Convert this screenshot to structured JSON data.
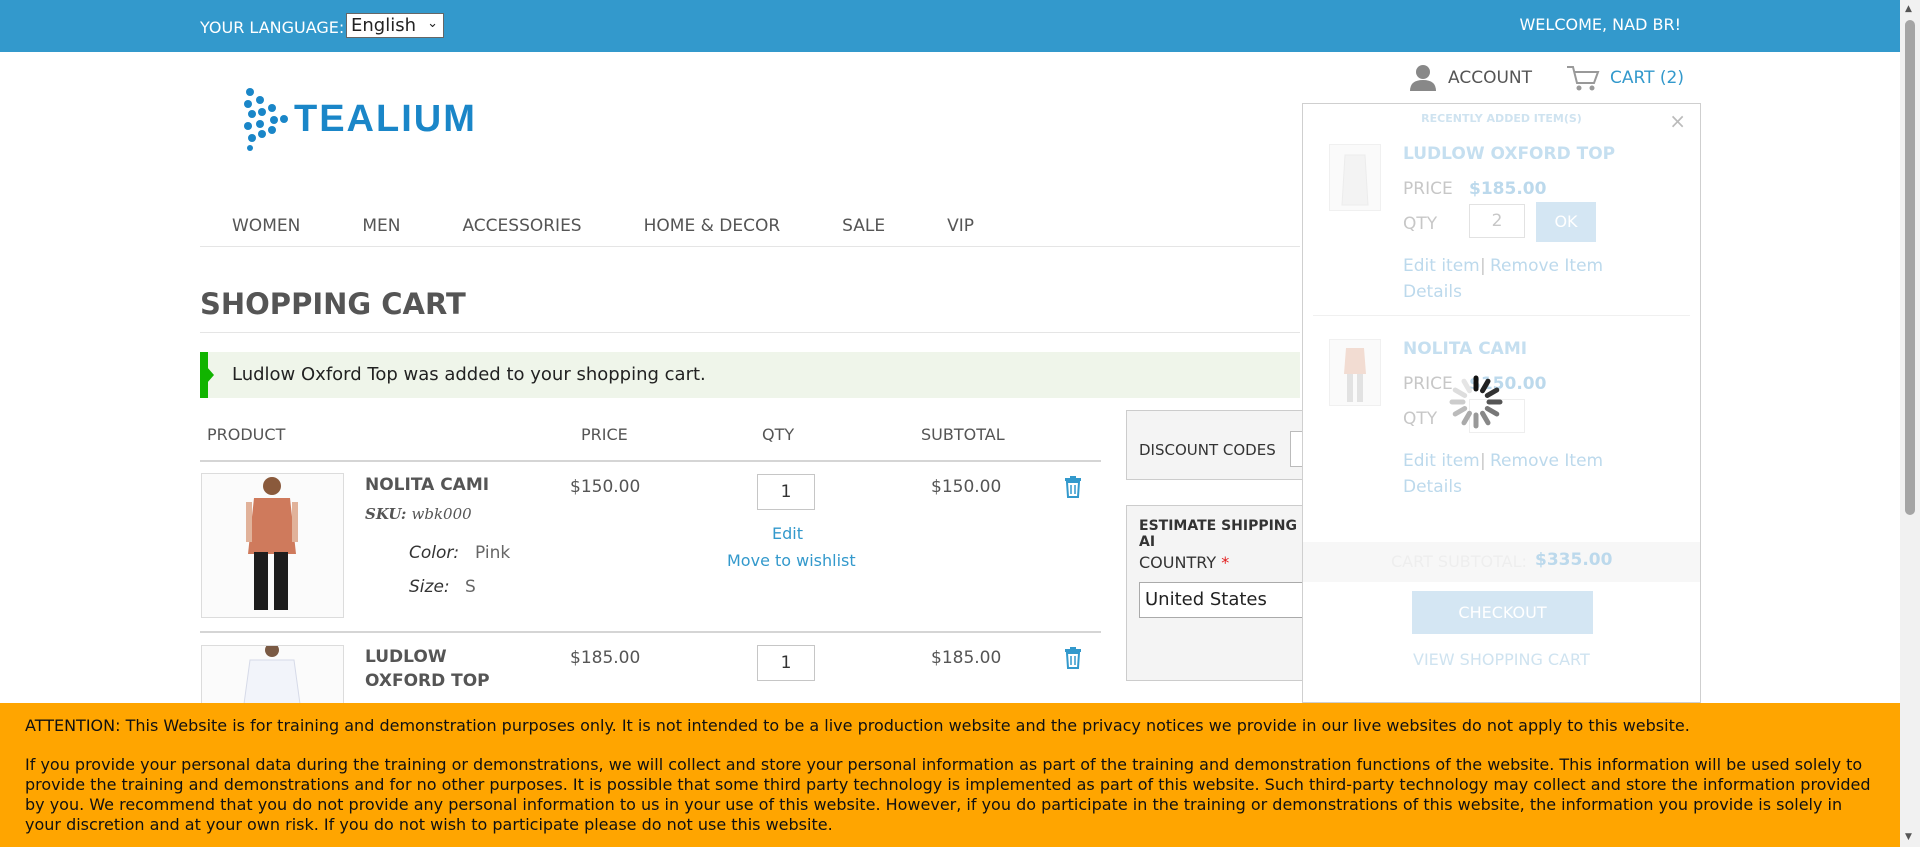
{
  "topbar": {
    "language_label": "YOUR LANGUAGE:",
    "language_value": "English",
    "welcome": "WELCOME, NAD BR!"
  },
  "header": {
    "account": "ACCOUNT",
    "cart": "CART",
    "cart_count": "(2)",
    "logo_text": "TEALIUM"
  },
  "nav": [
    "WOMEN",
    "MEN",
    "ACCESSORIES",
    "HOME & DECOR",
    "SALE",
    "VIP"
  ],
  "page": {
    "title": "SHOPPING CART",
    "success_message": "Ludlow Oxford Top was added to your shopping cart."
  },
  "cart_table": {
    "headers": [
      "PRODUCT",
      "PRICE",
      "QTY",
      "SUBTOTAL"
    ],
    "rows": [
      {
        "name": "NOLITA CAMI",
        "sku_label": "SKU:",
        "sku": "wbk000",
        "color_label": "Color:",
        "color": "Pink",
        "size_label": "Size:",
        "size": "S",
        "price": "$150.00",
        "qty": "1",
        "edit": "Edit",
        "wishlist": "Move to wishlist",
        "subtotal": "$150.00"
      },
      {
        "name_line1": "LUDLOW",
        "name_line2": "OXFORD TOP",
        "price": "$185.00",
        "qty": "1",
        "subtotal": "$185.00"
      }
    ]
  },
  "side": {
    "discount_label": "DISCOUNT CODES",
    "shipping_label": "ESTIMATE SHIPPING AI",
    "country_label": "COUNTRY",
    "required_mark": "*",
    "country_value": "United States"
  },
  "minicart": {
    "header": "RECENTLY ADDED ITEM(S)",
    "close": "×",
    "items": [
      {
        "name": "LUDLOW OXFORD TOP",
        "price_label": "PRICE",
        "price": "$185.00",
        "qty_label": "QTY",
        "qty": "2",
        "ok": "OK",
        "edit": "Edit item",
        "sep": "|",
        "remove": "Remove Item",
        "details": "Details"
      },
      {
        "name": "NOLITA CAMI",
        "price_label": "PRICE",
        "price": "$150.00",
        "qty_label": "QTY",
        "edit": "Edit item",
        "sep": "|",
        "remove": "Remove Item",
        "details": "Details"
      }
    ],
    "subtotal_label": "CART SUBTOTAL:",
    "subtotal": "$335.00",
    "checkout": "CHECKOUT",
    "view_cart": "VIEW SHOPPING CART"
  },
  "attention": {
    "line1": "ATTENTION: This Website is for training and demonstration purposes only. It is not intended to be a live production website and the privacy notices we provide in our live websites do not apply to this website.",
    "line2": "If you provide your personal data during the training or demonstrations, we will collect and store your personal information as part of the training and demonstration functions of the website. This information will be used solely to provide the training and demonstrations and for no other purposes. It is possible that some third party technology is implemented as part of this website. Such third-party technology may collect and store the information provided by you. We recommend that you do not provide any personal information to us in your use of this website. However, if you do participate in the training or demonstrations of this website, the information you provide is solely in your discretion and at your own risk. If you do not wish to participate please do not use this website."
  },
  "colors": {
    "topbar": "#3399cc",
    "accent": "#3399cc",
    "success": "#11b400",
    "attention": "#ffa500"
  }
}
